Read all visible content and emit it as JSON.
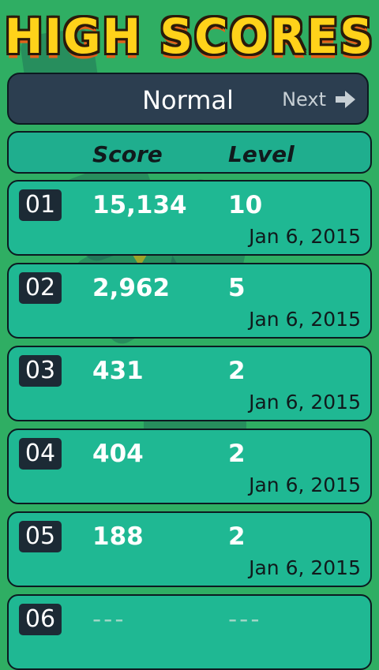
{
  "title": "HIGH SCORES",
  "mode": {
    "label": "Normal",
    "next_label": "Next",
    "next_icon": "right-arrow-icon"
  },
  "headers": {
    "score": "Score",
    "level": "Level"
  },
  "rows": [
    {
      "rank": "01",
      "score": "15,134",
      "level": "10",
      "date": "Jan 6, 2015"
    },
    {
      "rank": "02",
      "score": "2,962",
      "level": "5",
      "date": "Jan 6, 2015"
    },
    {
      "rank": "03",
      "score": "431",
      "level": "2",
      "date": "Jan 6, 2015"
    },
    {
      "rank": "04",
      "score": "404",
      "level": "2",
      "date": "Jan 6, 2015"
    },
    {
      "rank": "05",
      "score": "188",
      "level": "2",
      "date": "Jan 6, 2015"
    },
    {
      "rank": "06",
      "score": "---",
      "level": "---",
      "date": ""
    }
  ],
  "colors": {
    "background": "#2fae63",
    "title_fill": "#ffd21a",
    "title_shadow": "#e2621b",
    "bar": "#2c3e50",
    "row": "#1fb893",
    "rank_badge": "#1c2a35"
  }
}
